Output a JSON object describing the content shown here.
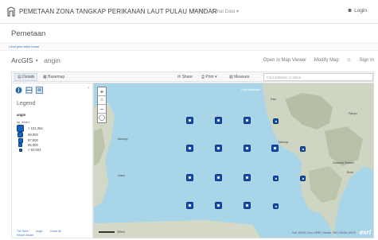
{
  "topnav": {
    "title": "PEMETAAN ZONA TANGKAP PERIKANAN LAUT PULAU MANDAR",
    "links": [
      "Home",
      "Lihat Data ▾"
    ],
    "login": "Login"
  },
  "page": {
    "title": "Pemetaan",
    "sub_link": "Lihat peta lebih besar"
  },
  "app": {
    "brand": "ArcGIS",
    "map_name": "angin",
    "links": [
      "Open in Map Viewer",
      "Modify Map",
      "Sign In"
    ]
  },
  "toolbar": {
    "details": "Details",
    "basemap": "Basemap",
    "share": "Share",
    "print": "Print",
    "measure": "Measure",
    "search_placeholder": "Find address or place"
  },
  "legend": {
    "title": "Legend",
    "layer": "angin",
    "field": "sp_time1",
    "items": [
      {
        "label": "> 101,354"
      },
      {
        "label": "99,000"
      },
      {
        "label": "97,000"
      },
      {
        "label": "95,000"
      },
      {
        "label": "< 92,604"
      }
    ],
    "footer_links": [
      "Tue Suhu",
      "angin",
      "Curah Air"
    ],
    "footer_link2": "Report Abuse"
  },
  "map": {
    "labels": {
      "laut": "Selat Makassar",
      "kota1": "Palu",
      "kota2": "Palopo",
      "kota3": "Mamuju",
      "region": "Sulawesi Selatan",
      "sea": "Bone",
      "left1": "Mamuju",
      "left2": "Utara"
    },
    "scale_label": "300mi",
    "attribution": "Esri, USGS | Esri, HERE, Garmin, FAO, NOAA, USGS",
    "esri_logo": "esri"
  },
  "colors": {
    "point_fill": "#1552b8",
    "ocean": "#a8d6e8",
    "land": "#cfd5c3"
  }
}
